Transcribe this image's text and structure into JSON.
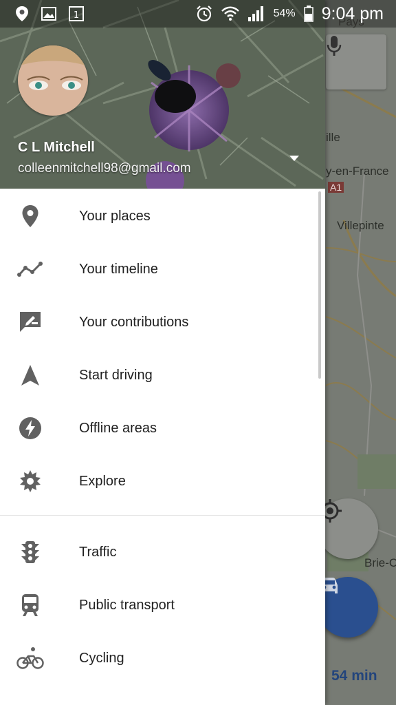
{
  "status_bar": {
    "battery_percent": "54%",
    "time": "9:04 pm",
    "icons": [
      "location-icon",
      "gallery-icon",
      "calendar-icon",
      "alarm-icon",
      "wifi-icon",
      "signal-icon",
      "battery-icon"
    ]
  },
  "account": {
    "name": "C L Mitchell",
    "email": "colleenmitchell98@gmail.com"
  },
  "menu": {
    "items": [
      {
        "label": "Your places",
        "icon": "place-pin-icon"
      },
      {
        "label": "Your timeline",
        "icon": "timeline-icon"
      },
      {
        "label": "Your contributions",
        "icon": "contributions-icon"
      },
      {
        "label": "Start driving",
        "icon": "navigation-arrow-icon"
      },
      {
        "label": "Offline areas",
        "icon": "offline-bolt-icon"
      },
      {
        "label": "Explore",
        "icon": "explore-icon"
      }
    ],
    "layers": [
      {
        "label": "Traffic",
        "icon": "traffic-light-icon"
      },
      {
        "label": "Public transport",
        "icon": "train-icon"
      },
      {
        "label": "Cycling",
        "icon": "bicycle-icon"
      }
    ]
  },
  "map": {
    "labels": [
      "Pays",
      "ille",
      "y-en-France",
      "A1",
      "Villepinte",
      "Brie-C"
    ],
    "eta": "54 min"
  },
  "colors": {
    "accent_blue": "#2a4f8f",
    "drawer_bg": "#ffffff",
    "menu_text": "#212121",
    "icon_gray": "#616161"
  }
}
